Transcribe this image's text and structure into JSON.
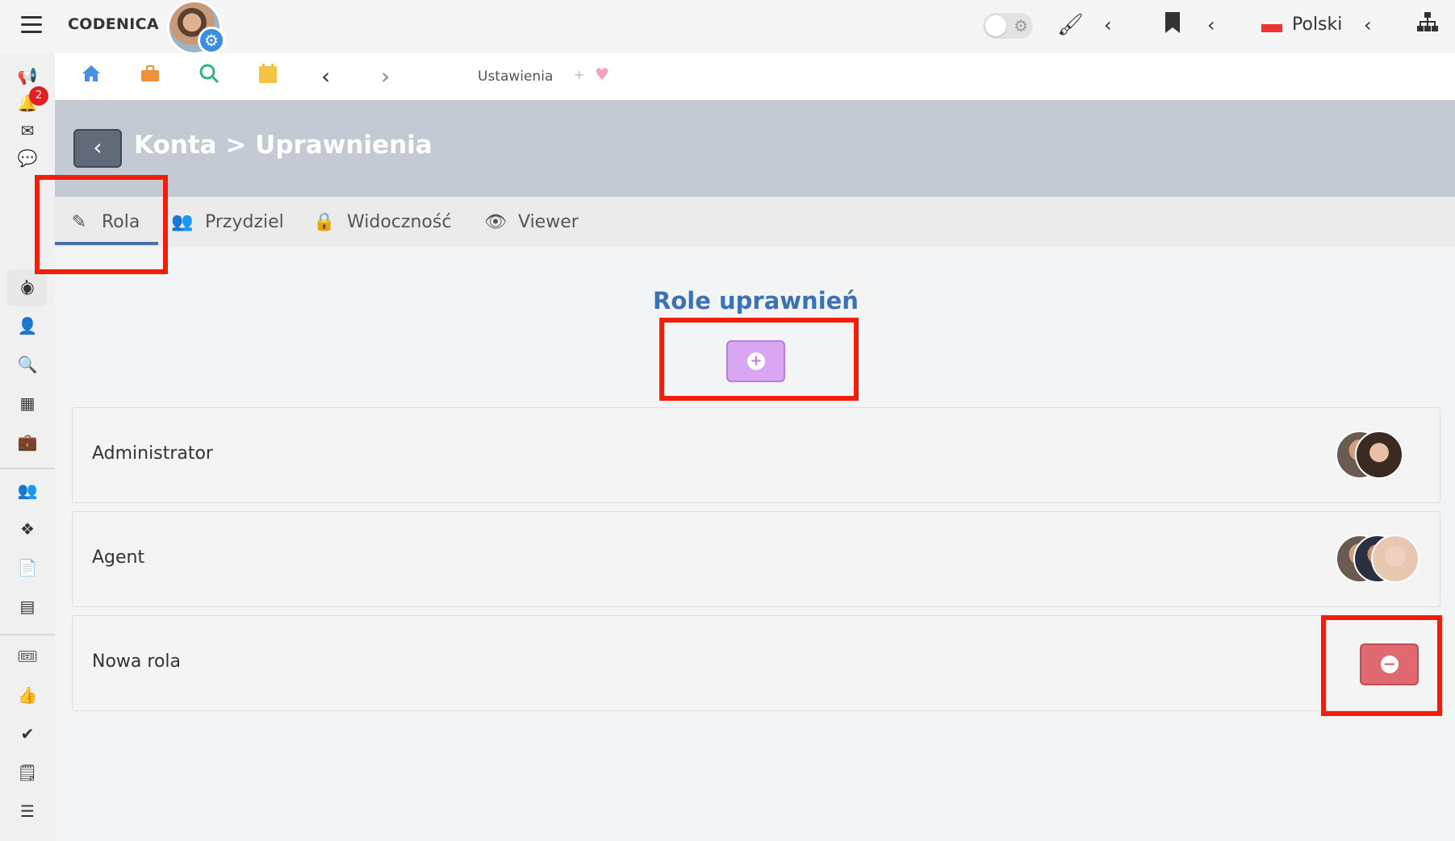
{
  "app": {
    "brand": "CODENICA",
    "language": "Polski",
    "notification_count": "2"
  },
  "topbar_icons": [
    "hamburger-icon",
    "theme-toggle",
    "brush-icon",
    "chevron-left-icon",
    "bookmark-icon",
    "chevron-left-icon",
    "flag-icon",
    "chevron-left-icon",
    "sitemap-icon"
  ],
  "subnav": {
    "breadcrumb": "Ustawienia",
    "plus": "+",
    "heart": "♥"
  },
  "header": {
    "title": "Konta > Uprawnienia"
  },
  "tabs": [
    {
      "label": "Rola",
      "icon": "edit-icon",
      "active": true
    },
    {
      "label": "Przydziel",
      "icon": "users-icon",
      "active": false
    },
    {
      "label": "Widoczność",
      "icon": "lock-icon",
      "active": false
    },
    {
      "label": "Viewer",
      "icon": "eye-icon",
      "active": false
    }
  ],
  "main": {
    "section_title": "Role uprawnień",
    "roles": [
      {
        "name": "Administrator",
        "avatars": 2
      },
      {
        "name": "Agent",
        "avatars": 3
      },
      {
        "name": "Nowa rola",
        "avatars": 0,
        "removable": true
      }
    ]
  },
  "colors": {
    "accent": "#3a72b5",
    "add_button": "#d8a6f2",
    "remove_button": "#e06a70",
    "highlight": "#f41d0a",
    "banner": "#c4cad3"
  }
}
